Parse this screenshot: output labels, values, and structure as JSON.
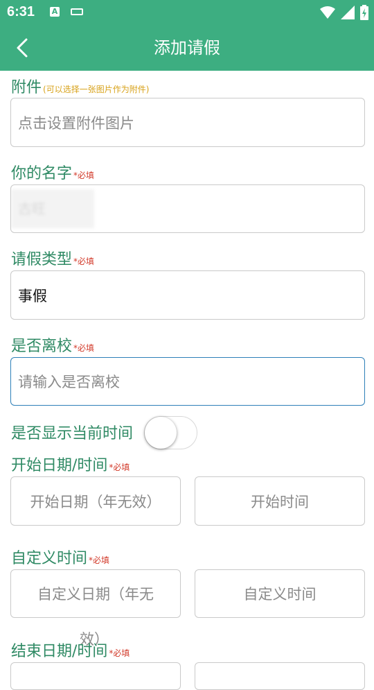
{
  "status": {
    "time": "6:31",
    "app_icon_letter": "A"
  },
  "header": {
    "title": "添加请假"
  },
  "form": {
    "attachment": {
      "label": "附件",
      "hint": "(可以选择一张图片作为附件)",
      "placeholder": "点击设置附件图片"
    },
    "name": {
      "label": "你的名字",
      "required": "*必填",
      "value_obscured": "古旺"
    },
    "leave_type": {
      "label": "请假类型",
      "required": "*必填",
      "value": "事假"
    },
    "leave_school": {
      "label": "是否离校",
      "required": "*必填",
      "placeholder": "请输入是否离校"
    },
    "show_time": {
      "label": "是否显示当前时间",
      "enabled": false
    },
    "start": {
      "label": "开始日期/时间",
      "required": "*必填",
      "date_placeholder": "开始日期（年无效）",
      "time_placeholder": "开始时间"
    },
    "custom": {
      "label": "自定义时间",
      "required": "*必填",
      "date_placeholder": "自定义日期（年无",
      "date_overflow": "效）",
      "time_placeholder": "自定义时间"
    },
    "end": {
      "label": "结束日期/时间",
      "required": "*必填"
    }
  },
  "colors": {
    "primary": "#3dae81",
    "label": "#2f8a64",
    "required": "#d23a2a",
    "hint": "#d8a21a",
    "focus_border": "#2d7fb8"
  }
}
